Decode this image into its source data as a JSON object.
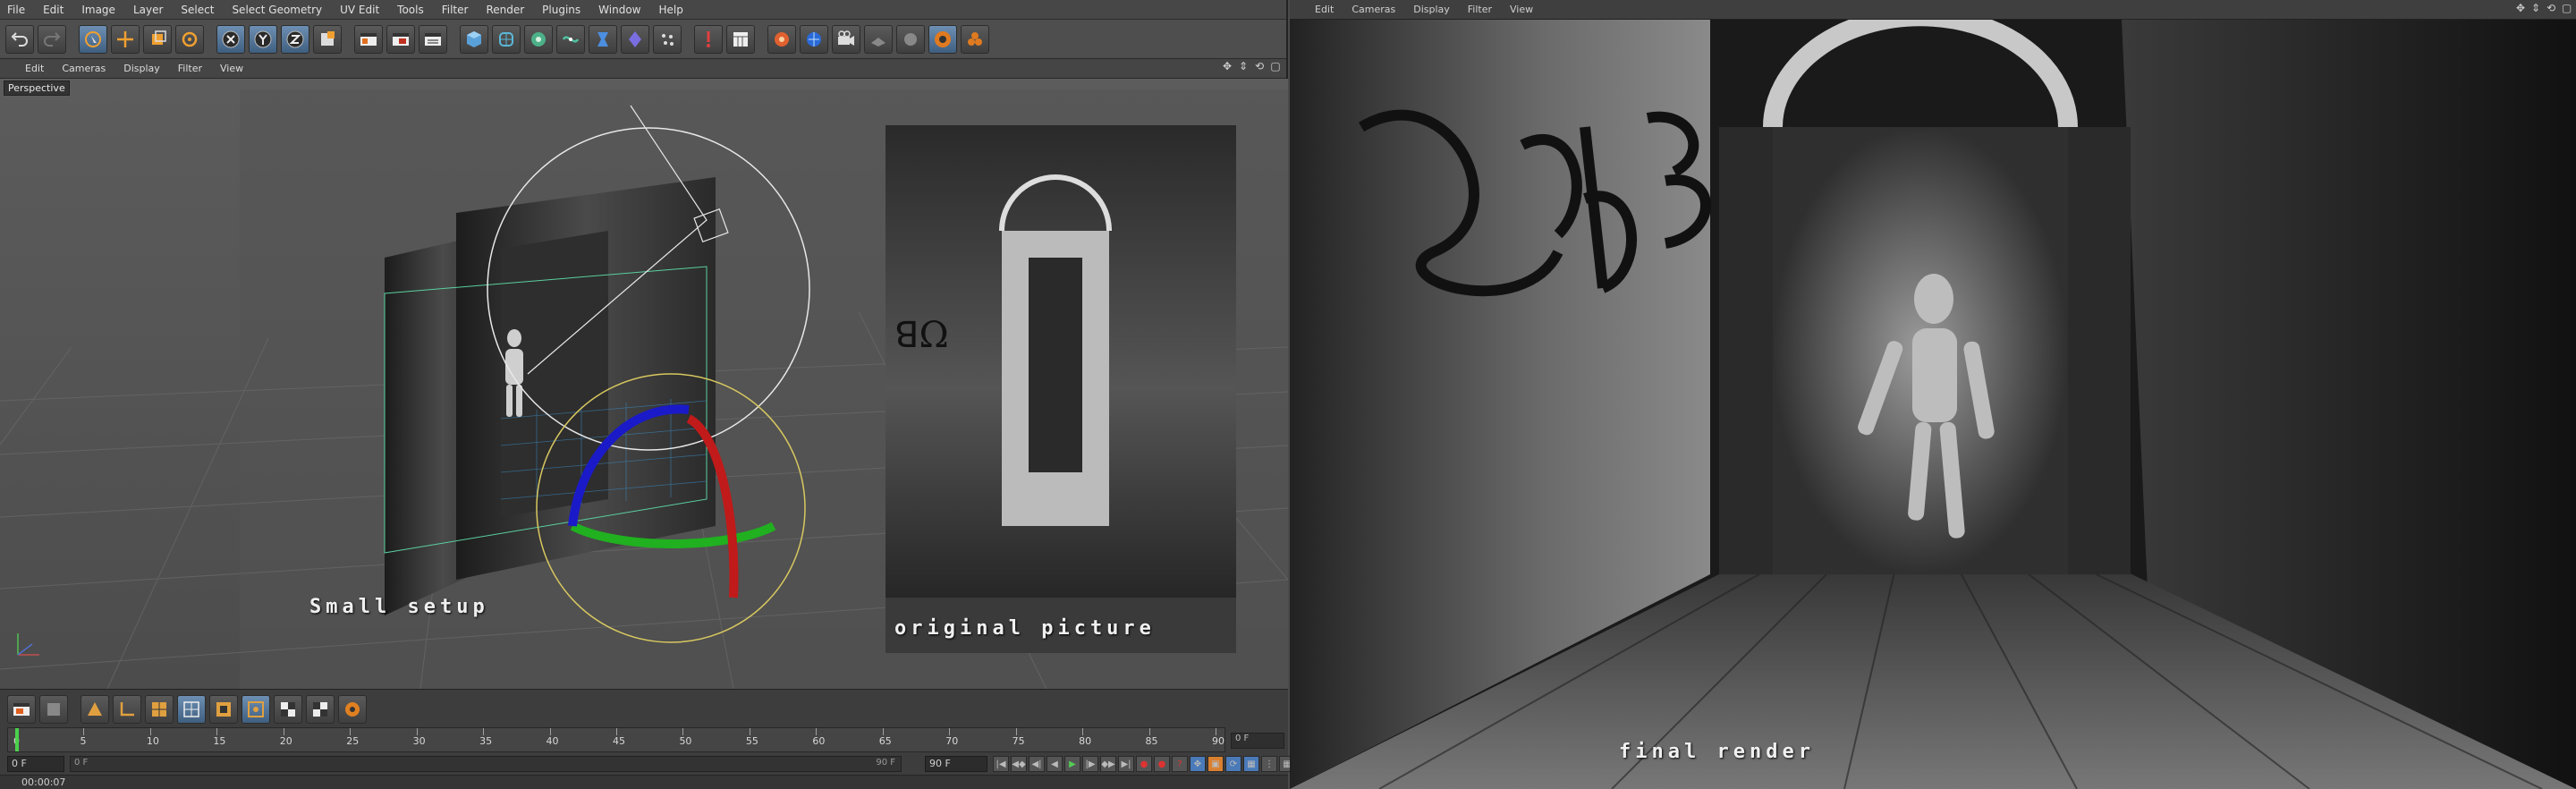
{
  "menu": {
    "items": [
      "File",
      "Edit",
      "Image",
      "Layer",
      "Select",
      "Select Geometry",
      "UV Edit",
      "Tools",
      "Filter",
      "Render",
      "Plugins",
      "Window",
      "Help"
    ]
  },
  "toolbar": {
    "icons": [
      "undo-icon",
      "redo-icon",
      "live-select-icon",
      "move-icon",
      "scale-icon",
      "rotate-icon",
      "x-axis-icon",
      "y-axis-icon",
      "z-axis-icon",
      "coordinate-system-icon",
      "render-view-icon",
      "render-picture-viewer-icon",
      "render-settings-icon",
      "cube-icon",
      "subdivision-icon",
      "array-icon",
      "spline-pen-icon",
      "deformer-icon",
      "scene-icon",
      "camera-icon",
      "light-icon",
      "floor-icon",
      "material-icon",
      "plugin-icon",
      "orange-icon"
    ]
  },
  "viewport": {
    "menu": [
      "Edit",
      "Cameras",
      "Display",
      "Filter",
      "View"
    ],
    "label": "Perspective",
    "caption_setup": "Small setup",
    "caption_original": "original picture"
  },
  "timeline": {
    "ticks": [
      "0",
      "5",
      "10",
      "15",
      "20",
      "25",
      "30",
      "35",
      "40",
      "45",
      "50",
      "55",
      "60",
      "65",
      "70",
      "75",
      "80",
      "85",
      "90"
    ],
    "current_frame": "0 F",
    "start_field": "0 F",
    "end_field": "90 F",
    "end_field2": "90 F",
    "range_label": "0 F",
    "time_readout": "00:00:07"
  },
  "render_window": {
    "menu": [
      "Edit",
      "Cameras",
      "Display",
      "Filter",
      "View"
    ],
    "caption": "final render"
  },
  "colors": {
    "accent": "#3f5f80",
    "selection": "#6d8fb3"
  }
}
